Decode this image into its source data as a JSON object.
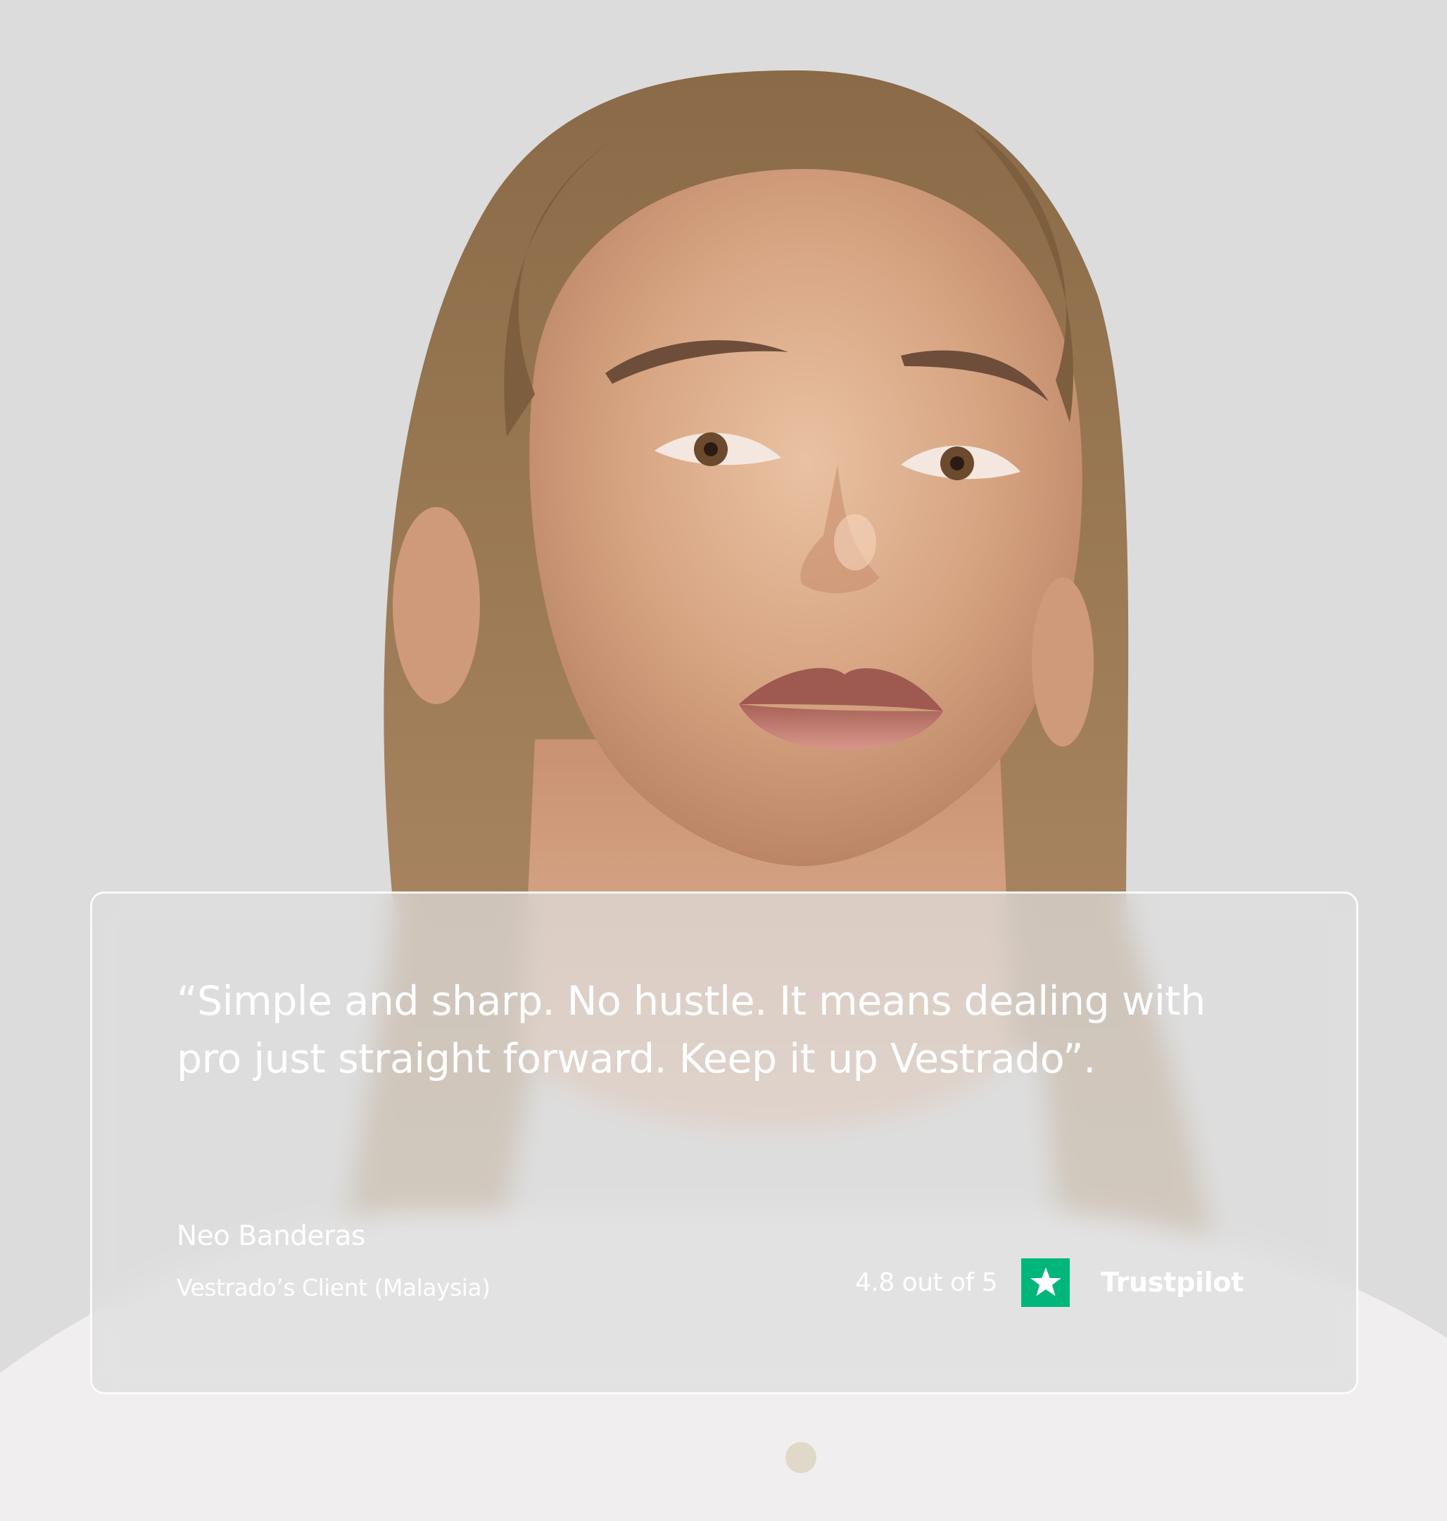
{
  "testimonial": {
    "quote_line_1": "“Simple and sharp. No hustle. It means dealing with",
    "quote_line_2": "pro just straight forward. Keep it up Vestrado”.",
    "author_name": "Neo Banderas",
    "author_role": "Vestrado’s Client (Malaysia)"
  },
  "rating": {
    "text": "4.8 out of 5",
    "brand": "Trustpilot",
    "icon": "trustpilot-star-icon",
    "accent_color": "#00b67a"
  },
  "background": {
    "color": "#dcdcdc",
    "image": "portrait-photo"
  }
}
